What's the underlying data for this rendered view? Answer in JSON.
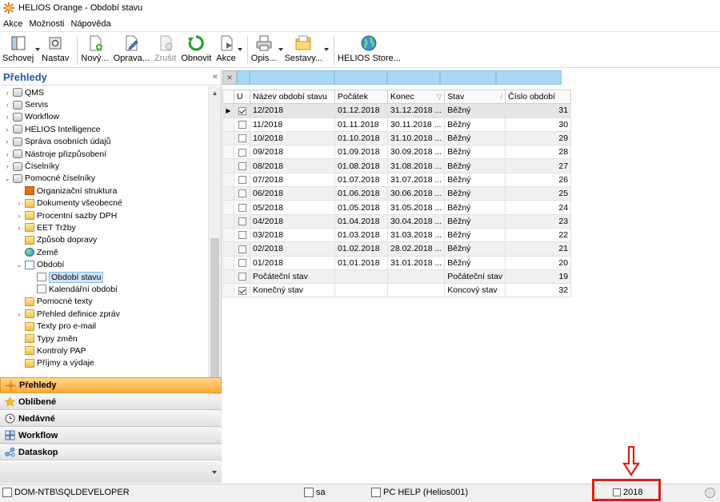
{
  "window": {
    "title": "HELIOS Orange - Období stavu"
  },
  "menu": [
    "Akce",
    "Možnosti",
    "Nápověda"
  ],
  "toolbar": [
    {
      "label": "Schovej",
      "icon": "window-icon",
      "drop": true,
      "enabled": true
    },
    {
      "label": "Nastav",
      "icon": "settings-icon",
      "drop": false,
      "enabled": true,
      "sep_after": true
    },
    {
      "label": "Nový...",
      "icon": "new-document-icon",
      "drop": false,
      "enabled": true
    },
    {
      "label": "Oprava...",
      "icon": "edit-icon",
      "drop": false,
      "enabled": true
    },
    {
      "label": "Zrušit",
      "icon": "delete-icon",
      "drop": false,
      "enabled": false
    },
    {
      "label": "Obnovit",
      "icon": "refresh-icon",
      "drop": false,
      "enabled": true
    },
    {
      "label": "Akce",
      "icon": "action-icon",
      "drop": true,
      "enabled": true,
      "sep_after": true
    },
    {
      "label": "Opis...",
      "icon": "printer-icon",
      "drop": true,
      "enabled": true
    },
    {
      "label": "Sestavy...",
      "icon": "folder-icon",
      "drop": true,
      "enabled": true,
      "sep_after": true
    },
    {
      "label": "HELIOS Store...",
      "icon": "globe-icon",
      "drop": false,
      "enabled": true
    }
  ],
  "left_panel": {
    "title": "Přehledy",
    "collapse_glyph": "«",
    "tree": [
      {
        "label": "QMS",
        "level": 0,
        "icon": "db",
        "exp": "›"
      },
      {
        "label": "Servis",
        "level": 0,
        "icon": "db",
        "exp": "›"
      },
      {
        "label": "Workflow",
        "level": 0,
        "icon": "db",
        "exp": "›"
      },
      {
        "label": "HELIOS Intelligence",
        "level": 0,
        "icon": "db",
        "exp": "›"
      },
      {
        "label": "Správa osobních údajů",
        "level": 0,
        "icon": "db",
        "exp": "›"
      },
      {
        "label": "Nástroje přizpůsobení",
        "level": 0,
        "icon": "db",
        "exp": "›"
      },
      {
        "label": "Číselníky",
        "level": 0,
        "icon": "db",
        "exp": "›"
      },
      {
        "label": "Pomocné číselníky",
        "level": 0,
        "icon": "db",
        "exp": "⌄"
      },
      {
        "label": "Organizační struktura",
        "level": 1,
        "icon": "org",
        "exp": ""
      },
      {
        "label": "Dokumenty všeobecné",
        "level": 1,
        "icon": "folder",
        "exp": "›"
      },
      {
        "label": "Procentní sazby DPH",
        "level": 1,
        "icon": "folder",
        "exp": "›"
      },
      {
        "label": "EET Tržby",
        "level": 1,
        "icon": "folder",
        "exp": "›"
      },
      {
        "label": "Způsob dopravy",
        "level": 1,
        "icon": "folder",
        "exp": ""
      },
      {
        "label": "Země",
        "level": 1,
        "icon": "globe",
        "exp": ""
      },
      {
        "label": "Období",
        "level": 1,
        "icon": "doc",
        "exp": "⌄"
      },
      {
        "label": "Období stavu",
        "level": 2,
        "icon": "period",
        "exp": "",
        "selected": true
      },
      {
        "label": "Kalendářní období",
        "level": 2,
        "icon": "period",
        "exp": ""
      },
      {
        "label": "Pomocné texty",
        "level": 1,
        "icon": "folder",
        "exp": ""
      },
      {
        "label": "Přehled definice zpráv",
        "level": 1,
        "icon": "folder",
        "exp": "›"
      },
      {
        "label": "Texty pro e-mail",
        "level": 1,
        "icon": "folder",
        "exp": ""
      },
      {
        "label": "Typy změn",
        "level": 1,
        "icon": "folder",
        "exp": ""
      },
      {
        "label": "Kontroly PAP",
        "level": 1,
        "icon": "folder",
        "exp": ""
      },
      {
        "label": "Příjmy a výdaje",
        "level": 1,
        "icon": "folder",
        "exp": ""
      }
    ],
    "nav_buttons": [
      {
        "label": "Přehledy",
        "icon": "overview-icon",
        "active": true
      },
      {
        "label": "Oblíbené",
        "icon": "star-icon",
        "active": false
      },
      {
        "label": "Nedávné",
        "icon": "clock-icon",
        "active": false
      },
      {
        "label": "Workflow",
        "icon": "workflow-icon",
        "active": false
      },
      {
        "label": "Dataskop",
        "icon": "dataskop-icon",
        "active": false
      }
    ]
  },
  "grid": {
    "columns": [
      "U",
      "Název období stavu",
      "Počátek",
      "Konec",
      "Stav",
      "Číslo období"
    ],
    "rows": [
      {
        "u": true,
        "name": "12/2018",
        "start": "01.12.2018",
        "end": "31.12.2018 ...",
        "state": "Běžný",
        "num": "31",
        "current": true
      },
      {
        "u": false,
        "name": "11/2018",
        "start": "01.11.2018",
        "end": "30.11.2018 ...",
        "state": "Běžný",
        "num": "30"
      },
      {
        "u": false,
        "name": "10/2018",
        "start": "01.10.2018",
        "end": "31.10.2018 ...",
        "state": "Běžný",
        "num": "29"
      },
      {
        "u": false,
        "name": "09/2018",
        "start": "01.09.2018",
        "end": "30.09.2018 ...",
        "state": "Běžný",
        "num": "28"
      },
      {
        "u": false,
        "name": "08/2018",
        "start": "01.08.2018",
        "end": "31.08.2018 ...",
        "state": "Běžný",
        "num": "27"
      },
      {
        "u": false,
        "name": "07/2018",
        "start": "01.07.2018",
        "end": "31.07.2018 ...",
        "state": "Běžný",
        "num": "26"
      },
      {
        "u": false,
        "name": "06/2018",
        "start": "01.06.2018",
        "end": "30.06.2018 ...",
        "state": "Běžný",
        "num": "25"
      },
      {
        "u": false,
        "name": "05/2018",
        "start": "01.05.2018",
        "end": "31.05.2018 ...",
        "state": "Běžný",
        "num": "24"
      },
      {
        "u": false,
        "name": "04/2018",
        "start": "01.04.2018",
        "end": "30.04.2018 ...",
        "state": "Běžný",
        "num": "23"
      },
      {
        "u": false,
        "name": "03/2018",
        "start": "01.03.2018",
        "end": "31.03.2018 ...",
        "state": "Běžný",
        "num": "22"
      },
      {
        "u": false,
        "name": "02/2018",
        "start": "01.02.2018",
        "end": "28.02.2018 ...",
        "state": "Běžný",
        "num": "21"
      },
      {
        "u": false,
        "name": "01/2018",
        "start": "01.01.2018",
        "end": "31.01.2018 ...",
        "state": "Běžný",
        "num": "20"
      },
      {
        "u": false,
        "name": "Počáteční stav",
        "start": "",
        "end": "",
        "state": "Počáteční stav",
        "num": "19"
      },
      {
        "u": true,
        "name": "Konečný stav",
        "start": "",
        "end": "",
        "state": "Koncový stav",
        "num": "32"
      }
    ]
  },
  "statusbar": {
    "server": "DOM-NTB\\SQLDEVELOPER",
    "user": "sa",
    "db": "PC HELP (Helios001)",
    "year": "2018"
  },
  "colors": {
    "accent": "#1f5aa6",
    "annotation": "#e21c12",
    "active_nav": "#ffa83a",
    "filter_row": "#a9d7f5"
  }
}
